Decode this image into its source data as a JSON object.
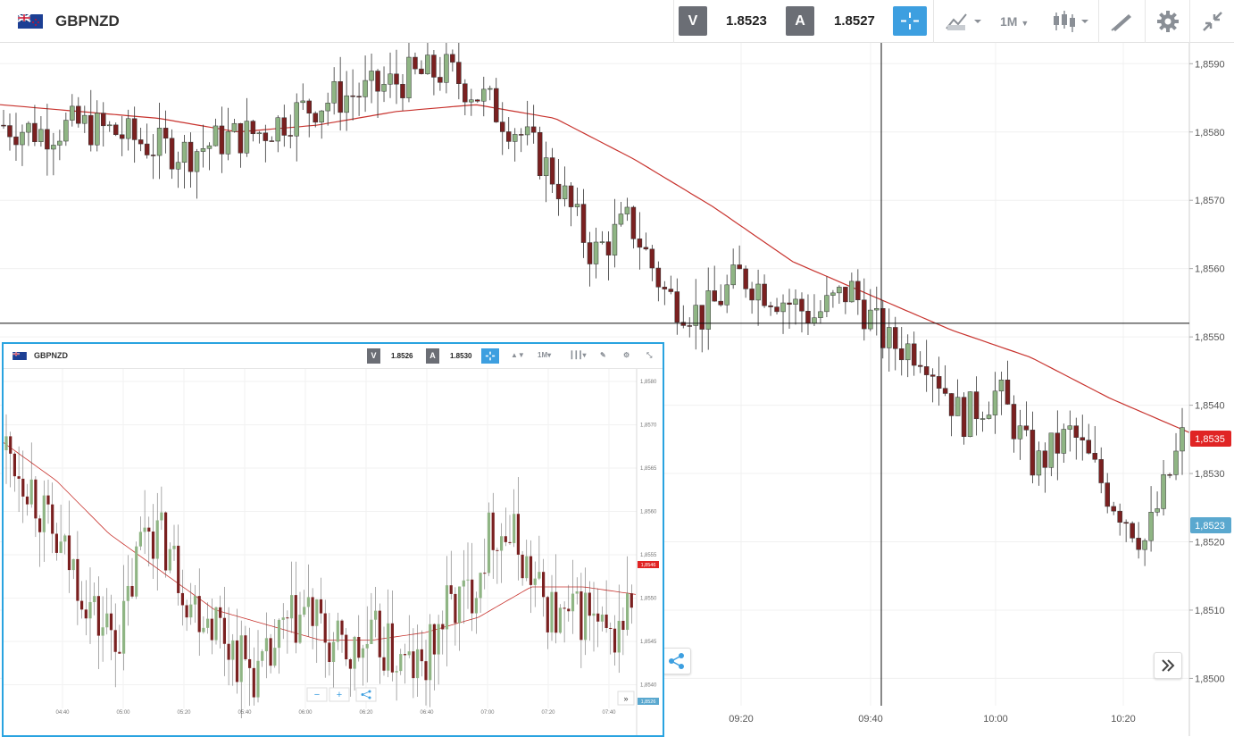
{
  "header": {
    "symbol": "GBPNZD",
    "sell_label": "V",
    "sell_price": "1.8523",
    "buy_label": "A",
    "buy_price": "1.8527",
    "timeframe": "1M"
  },
  "colors": {
    "up": "#8fb584",
    "down": "#7a2020",
    "ma": "#c8332e",
    "accent": "#3d9fe0",
    "bid_tag": "#5aa8cf",
    "last_tag": "#e02424"
  },
  "icons": [
    "flag-icon",
    "crosshair-icon",
    "chart-type-icon",
    "candlestick-icon",
    "draw-icon",
    "gear-icon",
    "collapse-icon",
    "share-icon",
    "fast-forward-icon"
  ],
  "main": {
    "current_price_tag": "1,8535",
    "bid_price_tag": "1,8523",
    "crosshair": {
      "time": "09:42",
      "price": 1.8552
    }
  },
  "chart_data": [
    {
      "type": "candlestick",
      "symbol": "GBPNZD",
      "ylim": [
        1.8496,
        1.8592
      ],
      "y_ticks": [
        "1,8590",
        "1,8580",
        "1,8570",
        "1,8560",
        "1,8550",
        "1,8540",
        "1,8530",
        "1,8520",
        "1,8510",
        "1,8500"
      ],
      "x_ticks": [
        "09:20",
        "09:40",
        "10:00",
        "10:20"
      ],
      "moving_average": [
        1.8584,
        1.8583,
        1.8582,
        1.858,
        1.8581,
        1.8583,
        1.8584,
        1.8582,
        1.8576,
        1.8569,
        1.8561,
        1.8556,
        1.8551,
        1.8547,
        1.8541,
        1.8536
      ],
      "close_series": [
        1.8581,
        1.858,
        1.8581,
        1.858,
        1.8578,
        1.8577,
        1.8579,
        1.858,
        1.8583,
        1.8585,
        1.8586,
        1.8588,
        1.8589,
        1.8585,
        1.858,
        1.8573,
        1.8562,
        1.8567,
        1.8556,
        1.8553,
        1.8559,
        1.8556,
        1.8553,
        1.8557,
        1.8549,
        1.8548,
        1.8538,
        1.8542,
        1.8531,
        1.8536,
        1.8527,
        1.852,
        1.8535
      ]
    },
    {
      "type": "candlestick",
      "symbol": "GBPNZD",
      "sell_price": "1.8526",
      "buy_price": "1.8530",
      "timeframe": "1M",
      "price_tag": "1,8546",
      "bid_tag": "1,8526",
      "y_ticks": [
        "1,8580",
        "1,8570",
        "1,8565",
        "1,8560",
        "1,8555",
        "1,8550",
        "1,8545",
        "1,8540"
      ],
      "x_ticks": [
        "04:40",
        "05:00",
        "05:20",
        "05:40",
        "06:00",
        "06:20",
        "06:40",
        "07:00",
        "07:20",
        "07:40"
      ],
      "close_series": [
        1.8572,
        1.8568,
        1.856,
        1.8556,
        1.8549,
        1.8548,
        1.8563,
        1.8559,
        1.8552,
        1.855,
        1.8545,
        1.8542,
        1.8548,
        1.8551,
        1.8546,
        1.8545,
        1.8547,
        1.8544,
        1.8543,
        1.8551,
        1.8553,
        1.8562,
        1.856,
        1.8553,
        1.8549,
        1.8551,
        1.8546,
        1.8552
      ]
    }
  ]
}
